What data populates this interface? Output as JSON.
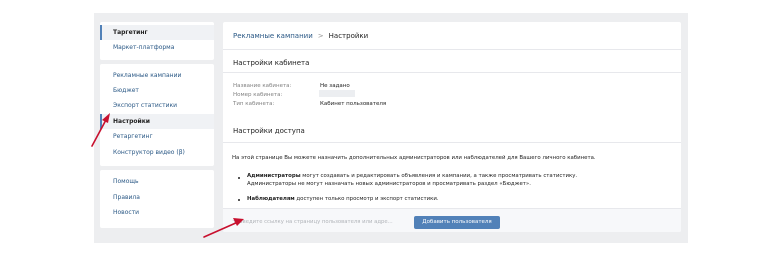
{
  "sidebar": {
    "group1": [
      {
        "label": "Таргетинг",
        "active": true
      },
      {
        "label": "Маркет-платформа",
        "active": false
      }
    ],
    "group2": [
      {
        "label": "Рекламные кампании",
        "active": false
      },
      {
        "label": "Бюджет",
        "active": false
      },
      {
        "label": "Экспорт статистики",
        "active": false
      },
      {
        "label": "Настройки",
        "active": true
      },
      {
        "label": "Ретаргетинг",
        "active": false
      },
      {
        "label": "Конструктор видео (β)",
        "active": false
      }
    ],
    "group3": [
      {
        "label": "Помощь",
        "active": false
      },
      {
        "label": "Правила",
        "active": false
      },
      {
        "label": "Новости",
        "active": false
      }
    ]
  },
  "breadcrumb": {
    "parent": "Рекламные кампании",
    "separator": ">",
    "current": "Настройки"
  },
  "cabinet": {
    "title": "Настройки кабинета",
    "fields": [
      {
        "label": "Название кабинета:",
        "value": "Не задано"
      },
      {
        "label": "Номер кабинета:",
        "value": ""
      },
      {
        "label": "Тип кабинета:",
        "value": "Кабинет пользователя"
      }
    ]
  },
  "access": {
    "title": "Настройки доступа",
    "intro": "На этой странице Вы можете назначить дополнительных администраторов или наблюдателей для Вашего личного кабинета.",
    "admins_strong": "Администраторы",
    "admins_line1_rest": " могут создавать и редактировать объявления и кампании, а также просматривать статистику.",
    "admins_line2": "Администраторы не могут назначать новых администраторов и просматривать раздел «Бюджет».",
    "observers_strong": "Наблюдателям",
    "observers_rest": " доступен только просмотр и экспорт статистики.",
    "input_placeholder": "Введите ссылку на страницу пользователя или адре...",
    "input_value": "",
    "add_button": "Добавить пользователя"
  },
  "colors": {
    "accent": "#5181b8",
    "link": "#2a5885",
    "page_bg": "#edeef0",
    "annotation_arrow": "#c8102e"
  },
  "icons": {
    "input_prefix": "plus-icon"
  }
}
